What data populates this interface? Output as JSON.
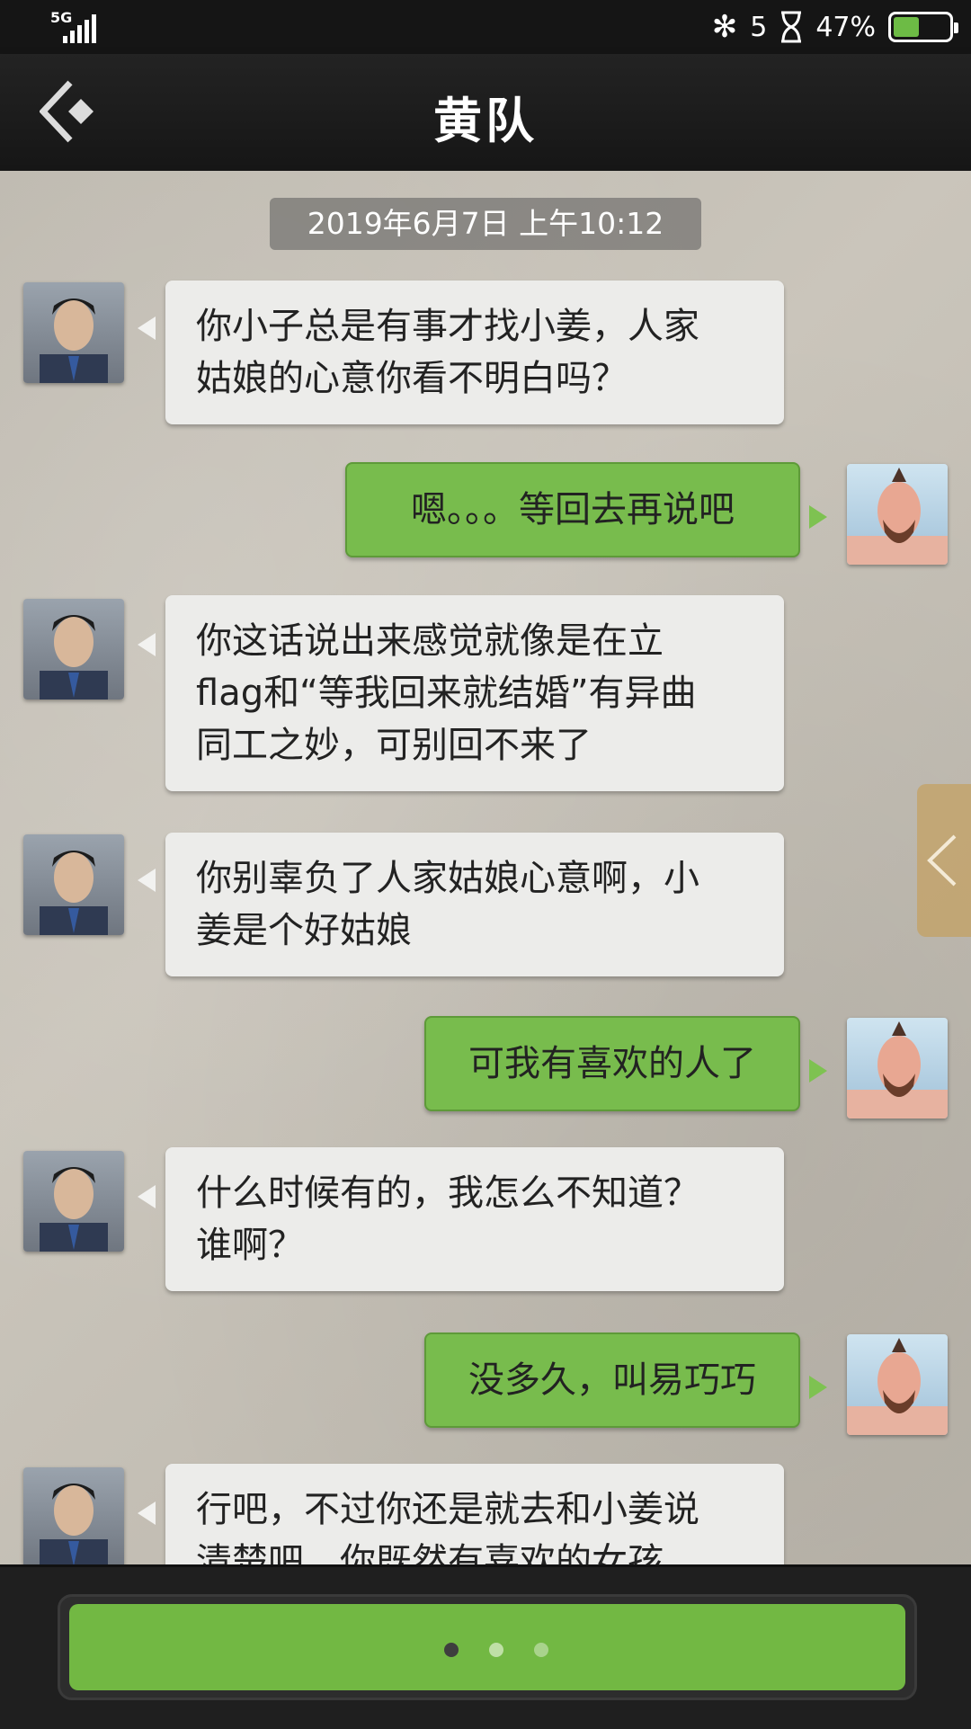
{
  "status_bar": {
    "network": "5G",
    "notification_count": "5",
    "battery_percent": "47%",
    "battery_level": 0.47
  },
  "header": {
    "title": "黄队"
  },
  "chat": {
    "timestamp": "2019年6月7日 上午10:12",
    "messages": [
      {
        "sender": "incoming",
        "lines": [
          "你小子总是有事才找小姜，人家",
          "姑娘的心意你看不明白吗？"
        ]
      },
      {
        "sender": "outgoing",
        "lines": [
          "嗯。。。等回去再说吧"
        ]
      },
      {
        "sender": "incoming",
        "lines": [
          "你这话说出来感觉就像是在立",
          "flag和“等我回来就结婚”有异曲",
          "同工之妙，可别回不来了"
        ]
      },
      {
        "sender": "incoming",
        "lines": [
          "你别辜负了人家姑娘心意啊，小",
          "姜是个好姑娘"
        ]
      },
      {
        "sender": "outgoing",
        "lines": [
          "可我有喜欢的人了"
        ]
      },
      {
        "sender": "incoming",
        "lines": [
          "什么时候有的，我怎么不知道？",
          "谁啊？"
        ]
      },
      {
        "sender": "outgoing",
        "lines": [
          "没多久，叫易巧巧"
        ]
      },
      {
        "sender": "incoming",
        "lines": [
          "行吧，不过你还是就去和小姜说",
          "清楚吧，你既然有喜欢的女孩"
        ]
      }
    ]
  },
  "colors": {
    "outgoing_bubble": "#78bc4d",
    "incoming_bubble": "#ececea",
    "input_button": "#72b843"
  }
}
